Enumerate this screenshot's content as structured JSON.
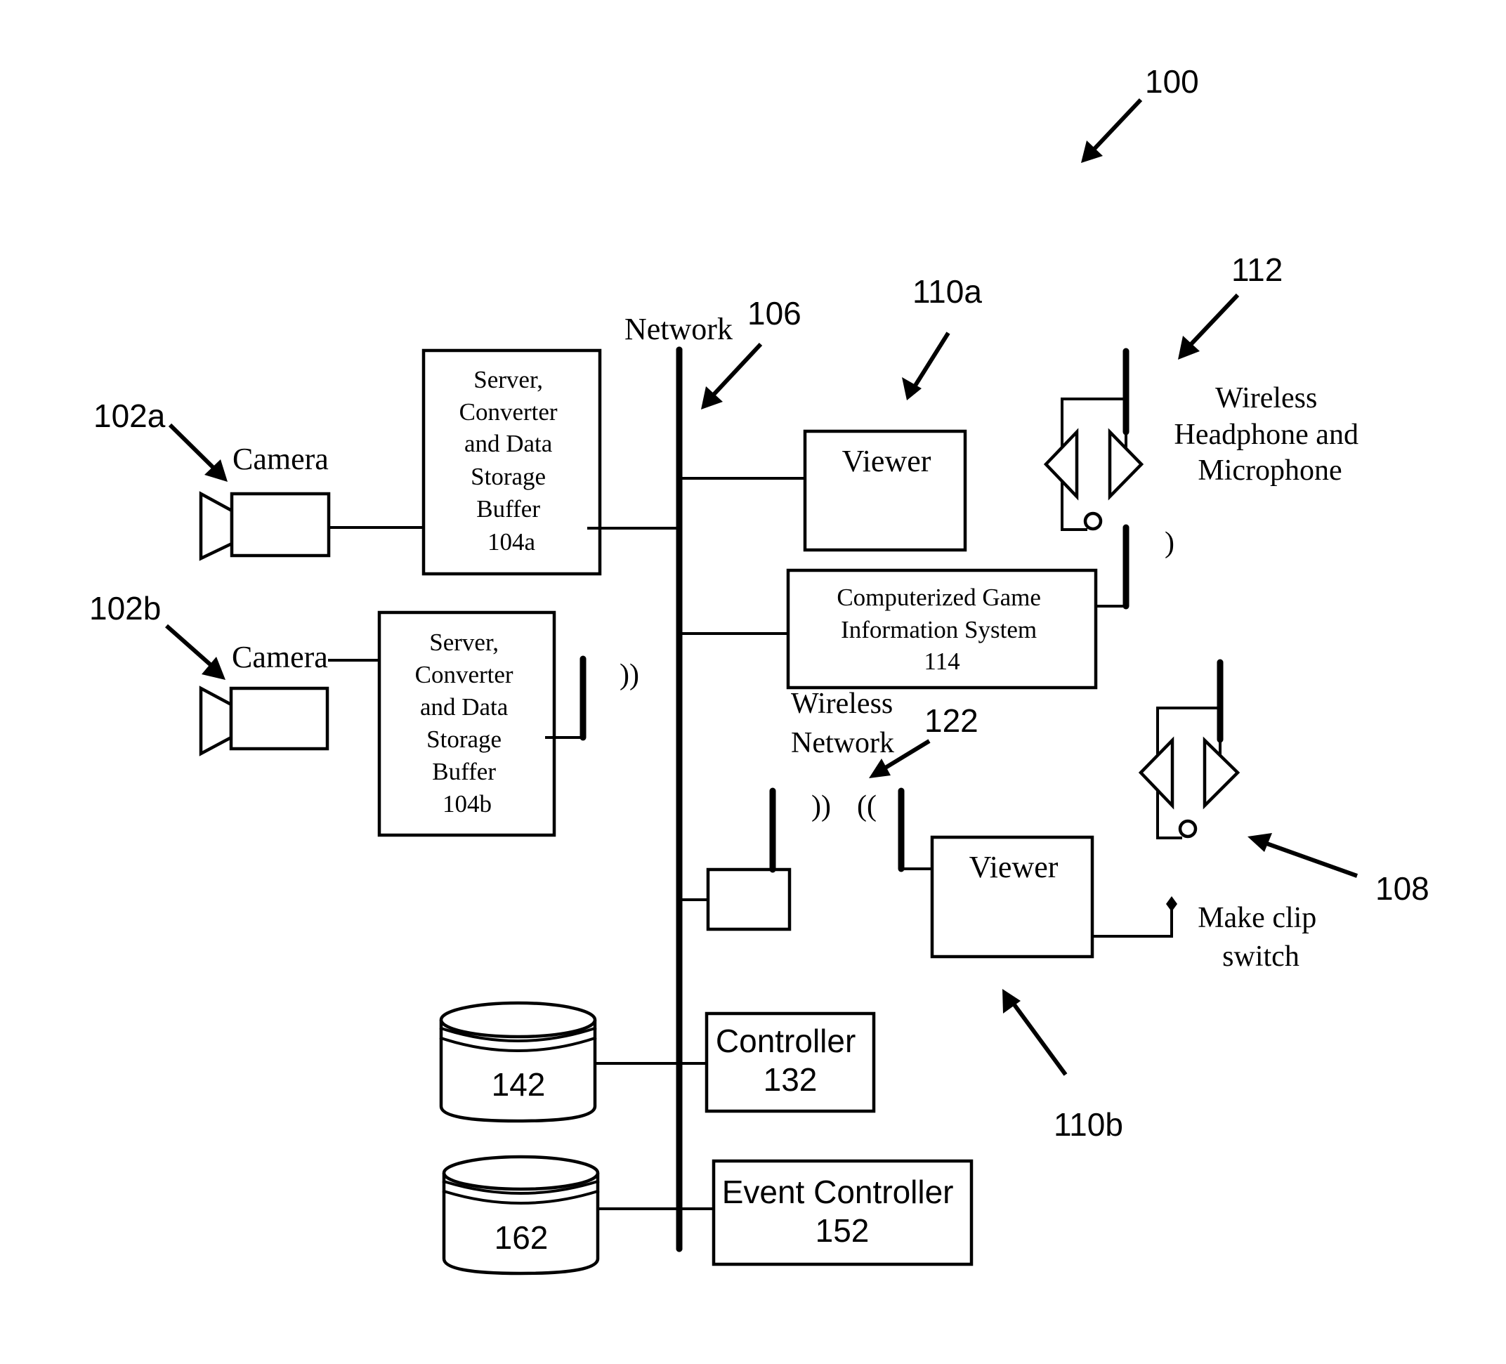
{
  "figure": {
    "reference": "100",
    "colors": {
      "ink": "#000000",
      "background": "#ffffff"
    }
  },
  "network": {
    "label": "Network",
    "reference": "106"
  },
  "cameras": [
    {
      "reference": "102a",
      "label": "Camera"
    },
    {
      "reference": "102b",
      "label": "Camera"
    }
  ],
  "buffers": [
    {
      "lines": [
        "Server,",
        "Converter",
        "and Data",
        "Storage",
        "Buffer",
        "104a"
      ]
    },
    {
      "lines": [
        "Server,",
        "Converter",
        "and Data",
        "Storage",
        "Buffer",
        "104b"
      ]
    }
  ],
  "viewer_a": {
    "reference": "110a",
    "label": "Viewer"
  },
  "viewer_b": {
    "reference": "110b",
    "label": "Viewer"
  },
  "headphone": {
    "reference": "112",
    "lines": [
      "Wireless",
      "Headphone and",
      "Microphone"
    ],
    "signal": ")"
  },
  "game_info": {
    "lines": [
      "Computerized Game",
      "Information System",
      "114"
    ]
  },
  "wireless_network": {
    "lines": [
      "Wireless",
      "Network"
    ],
    "reference": "122",
    "signal_out": "))",
    "signal_in": "(("
  },
  "buffer_b_signal": "))",
  "headset": {
    "reference": "108"
  },
  "clip_switch": {
    "lines": [
      "Make clip",
      "switch"
    ]
  },
  "databases": [
    {
      "label": "142"
    },
    {
      "label": "162"
    }
  ],
  "controller": {
    "lines": [
      "Controller",
      "132"
    ]
  },
  "event_controller": {
    "lines": [
      "Event Controller",
      "152"
    ]
  }
}
